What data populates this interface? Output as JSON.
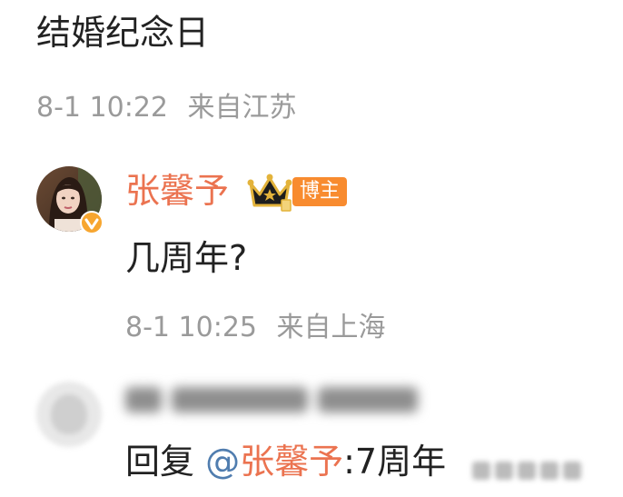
{
  "post": {
    "text": "结婚纪念日",
    "time": "8-1 10:22",
    "location": "来自江苏"
  },
  "comment": {
    "author": "张馨予",
    "author_tag": "博主",
    "text": "几周年?",
    "time": "8-1 10:25",
    "location": "来自上海",
    "name_color": "#eb7350",
    "tag_color": "#f88b2f"
  },
  "reply": {
    "prefix": "回复",
    "at_sign": "@",
    "mention": "张馨予",
    "text": ":7周年"
  },
  "colors": {
    "text": "#222222",
    "meta": "#9a9a9a",
    "link": "#507daf"
  },
  "icons": {
    "verified": "verified-badge-icon",
    "crown": "crown-icon"
  }
}
